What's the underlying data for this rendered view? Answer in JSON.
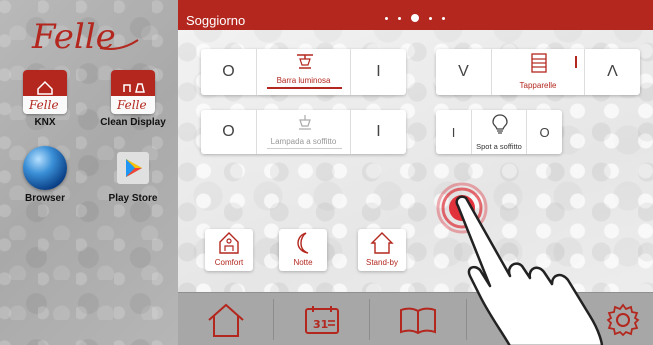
{
  "launcher": {
    "logo_text": "Felle",
    "apps": [
      {
        "label": "KNX",
        "icon": "home-icon"
      },
      {
        "label": "Clean Display",
        "icon": "cleaning-icon"
      },
      {
        "label": "Browser",
        "icon": "globe-icon"
      },
      {
        "label": "Play Store",
        "icon": "play-store-icon"
      }
    ]
  },
  "header": {
    "room": "Soggiorno",
    "page_count": 5,
    "active_page": 3
  },
  "controls": {
    "barra": {
      "label": "Barra luminosa",
      "off": "O",
      "on": "I"
    },
    "lampada": {
      "label": "Lampada a soffitto",
      "off": "O",
      "on": "I"
    },
    "tapparelle": {
      "label": "Tapparelle",
      "down": "V",
      "up": "Λ"
    },
    "spot": {
      "label": "Spot a soffitto",
      "on": "I",
      "off": "O"
    }
  },
  "scenes": [
    {
      "label": "Comfort",
      "icon": "comfort-house-icon"
    },
    {
      "label": "Notte",
      "icon": "moon-icon"
    },
    {
      "label": "Stand-by",
      "icon": "house-outline-icon"
    }
  ],
  "bottom_nav": [
    {
      "icon": "home-icon"
    },
    {
      "icon": "calendar-icon",
      "text": "31"
    },
    {
      "icon": "book-icon"
    },
    {
      "icon": "blank"
    },
    {
      "icon": "gear-icon"
    }
  ],
  "colors": {
    "accent": "#b3271e",
    "card": "#ffffff",
    "bar": "#a7a7a7"
  }
}
